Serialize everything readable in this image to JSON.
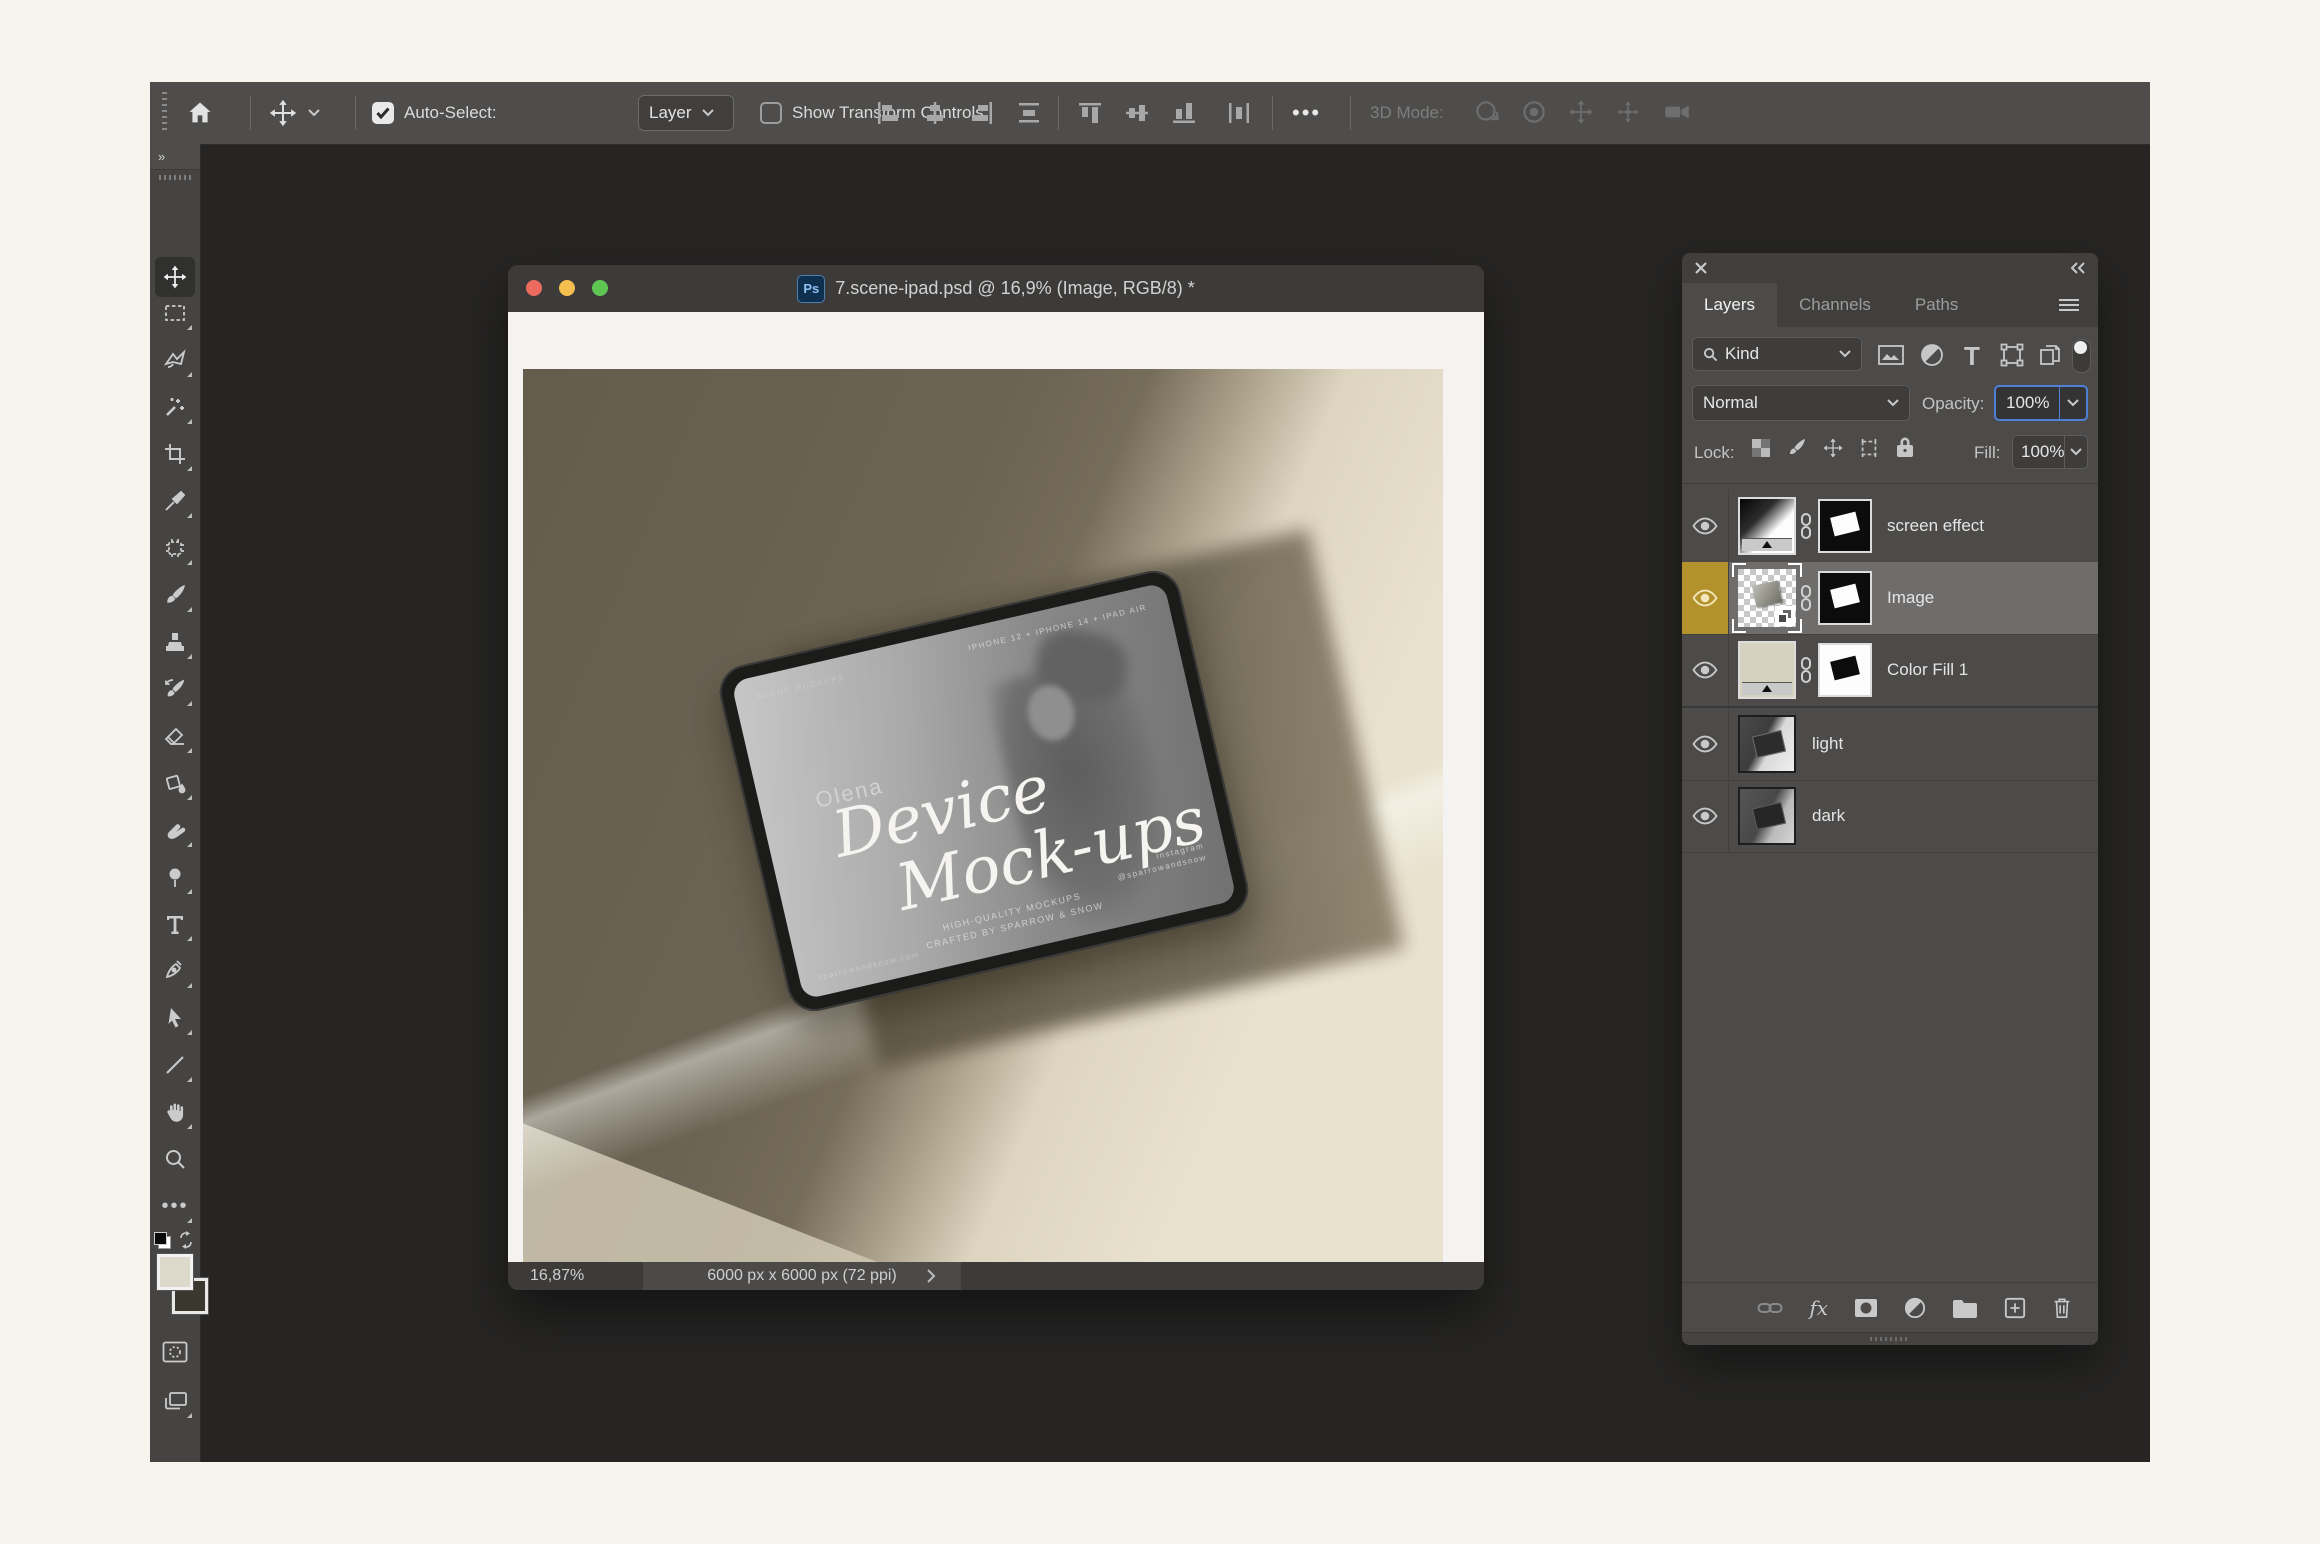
{
  "options_bar": {
    "auto_select_label": "Auto-Select:",
    "auto_select_checked": true,
    "auto_select_value": "Layer",
    "show_transform_label": "Show Transform Controls",
    "show_transform_checked": false,
    "mode_3d_label": "3D Mode:",
    "align_icons": [
      "align-left",
      "align-center-horizontal",
      "align-right",
      "distribute-horizontal",
      "align-top",
      "align-middle",
      "align-bottom",
      "distribute-vertical"
    ],
    "mode_3d_icons": [
      "3d-orbit",
      "3d-roll",
      "3d-pan",
      "3d-slide",
      "3d-camera"
    ]
  },
  "toolbar": {
    "expand_label": "»",
    "tools": [
      "move",
      "rectangular-marquee",
      "lasso",
      "magic-wand",
      "crop",
      "eyedropper",
      "healing-brush",
      "brush",
      "clone-stamp",
      "history-brush",
      "eraser",
      "paint-bucket",
      "smudge",
      "dodge",
      "type",
      "pen",
      "path-selection",
      "line",
      "hand",
      "zoom",
      "more-tools"
    ],
    "selected_tool": "move",
    "foreground_color": "#dcd9ca",
    "background_color": "#3a372e"
  },
  "document": {
    "title": "7.scene-ipad.psd @ 16,9% (Image, RGB/8) *",
    "badge": "Ps",
    "zoom_level": "16,87%",
    "dimensions": "6000 px x 6000 px (72 ppi)",
    "canvas": {
      "brand": "Olena",
      "title_line1": "Device",
      "title_line2": "Mock-ups",
      "top_left_caption": "SCENE MOCKUPS",
      "top_right_caption": "IPHONE 12 + IPHONE 14 + IPAD AIR",
      "caption_line1": "HIGH-QUALITY MOCKUPS",
      "caption_line2": "CRAFTED BY SPARROW & SNOW",
      "bottom_right_caption1": "instagram",
      "bottom_right_caption2": "@sparrowandsnow",
      "bottom_left_caption": "sparrowandsnow.com"
    }
  },
  "layers_panel": {
    "tabs": [
      "Layers",
      "Channels",
      "Paths"
    ],
    "active_tab": "Layers",
    "filter_label": "Kind",
    "blend_mode": "Normal",
    "opacity_label": "Opacity:",
    "opacity_value": "100%",
    "lock_label": "Lock:",
    "fill_label": "Fill:",
    "fill_value": "100%",
    "layers": [
      {
        "name": "screen effect",
        "visible": true,
        "selected": false,
        "type": "gradient-fill",
        "has_mask": true
      },
      {
        "name": "Image",
        "visible": true,
        "selected": true,
        "type": "smart-object",
        "has_mask": true
      },
      {
        "name": "Color Fill 1",
        "visible": true,
        "selected": false,
        "type": "color-fill",
        "has_mask": true
      },
      {
        "name": "light",
        "visible": true,
        "selected": false,
        "type": "image",
        "has_mask": false
      },
      {
        "name": "dark",
        "visible": true,
        "selected": false,
        "type": "image",
        "has_mask": false
      }
    ],
    "selected_highlight_color": "#b3912b"
  },
  "colors": {
    "frame_background": "#f6f4ec",
    "pasteboard": "#262524",
    "bars": "#4e4d4c",
    "panel": "#4c4b4a",
    "scene_dark": "#6b6353",
    "scene_light": "#e9e2cf",
    "focus_ring": "#4e80d6"
  }
}
